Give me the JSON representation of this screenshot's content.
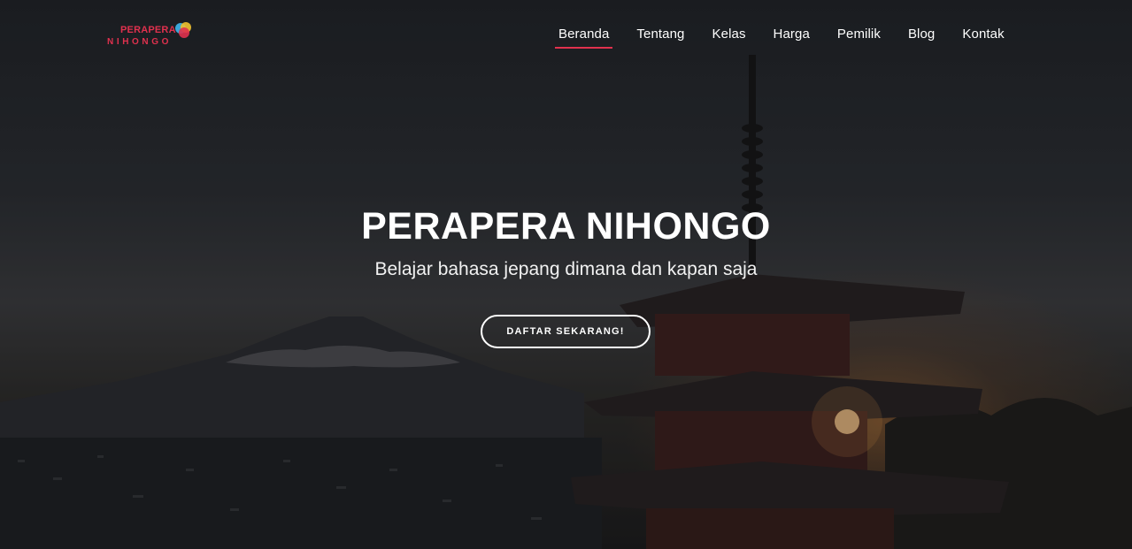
{
  "brand": {
    "line1": "PERAPERA",
    "line2": "NIHONGO",
    "colors": {
      "primary": "#e0314e",
      "dot_blue": "#3aa6d8",
      "dot_yellow": "#f2c230",
      "dot_red": "#e0314e"
    }
  },
  "nav": {
    "items": [
      {
        "label": "Beranda",
        "active": true
      },
      {
        "label": "Tentang",
        "active": false
      },
      {
        "label": "Kelas",
        "active": false
      },
      {
        "label": "Harga",
        "active": false
      },
      {
        "label": "Pemilik",
        "active": false
      },
      {
        "label": "Blog",
        "active": false
      },
      {
        "label": "Kontak",
        "active": false
      }
    ],
    "active_underline_color": "#e0314e"
  },
  "hero": {
    "title": "PERAPERA NIHONGO",
    "subtitle": "Belajar bahasa jepang dimana dan kapan saja",
    "cta_label": "DAFTAR SEKARANG!",
    "background_scene": "pagoda-and-mount-fuji-at-sunset"
  }
}
